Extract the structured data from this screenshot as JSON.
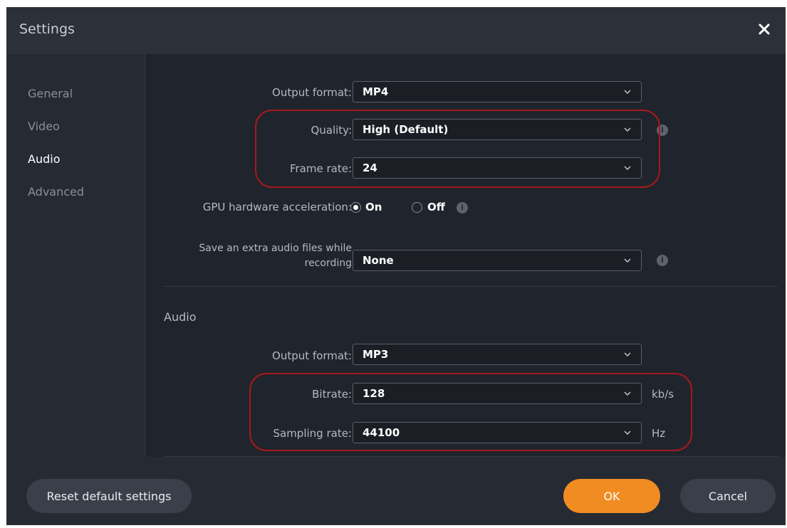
{
  "window": {
    "title": "Settings"
  },
  "sidebar": {
    "items": [
      {
        "label": "General",
        "active": false
      },
      {
        "label": "Video",
        "active": false
      },
      {
        "label": "Audio",
        "active": true
      },
      {
        "label": "Advanced",
        "active": false
      }
    ]
  },
  "video": {
    "output_format": {
      "label": "Output format:",
      "value": "MP4"
    },
    "quality": {
      "label": "Quality:",
      "value": "High (Default)"
    },
    "frame_rate": {
      "label": "Frame rate:",
      "value": "24"
    },
    "gpu": {
      "label": "GPU hardware acceleration:",
      "on_label": "On",
      "off_label": "Off",
      "selected": "On"
    },
    "extra_audio": {
      "label_line1": "Save an extra audio files while",
      "label_line2": "recording",
      "value": "None"
    }
  },
  "audio": {
    "section_title": "Audio",
    "output_format": {
      "label": "Output format:",
      "value": "MP3"
    },
    "bitrate": {
      "label": "Bitrate:",
      "value": "128",
      "unit": "kb/s"
    },
    "sampling_rate": {
      "label": "Sampling rate:",
      "value": "44100",
      "unit": "Hz"
    }
  },
  "footer": {
    "reset_label": "Reset default settings",
    "ok_label": "OK",
    "cancel_label": "Cancel"
  },
  "colors": {
    "accent": "#f08c21",
    "highlight": "#a8191d",
    "background": "#20242c"
  }
}
